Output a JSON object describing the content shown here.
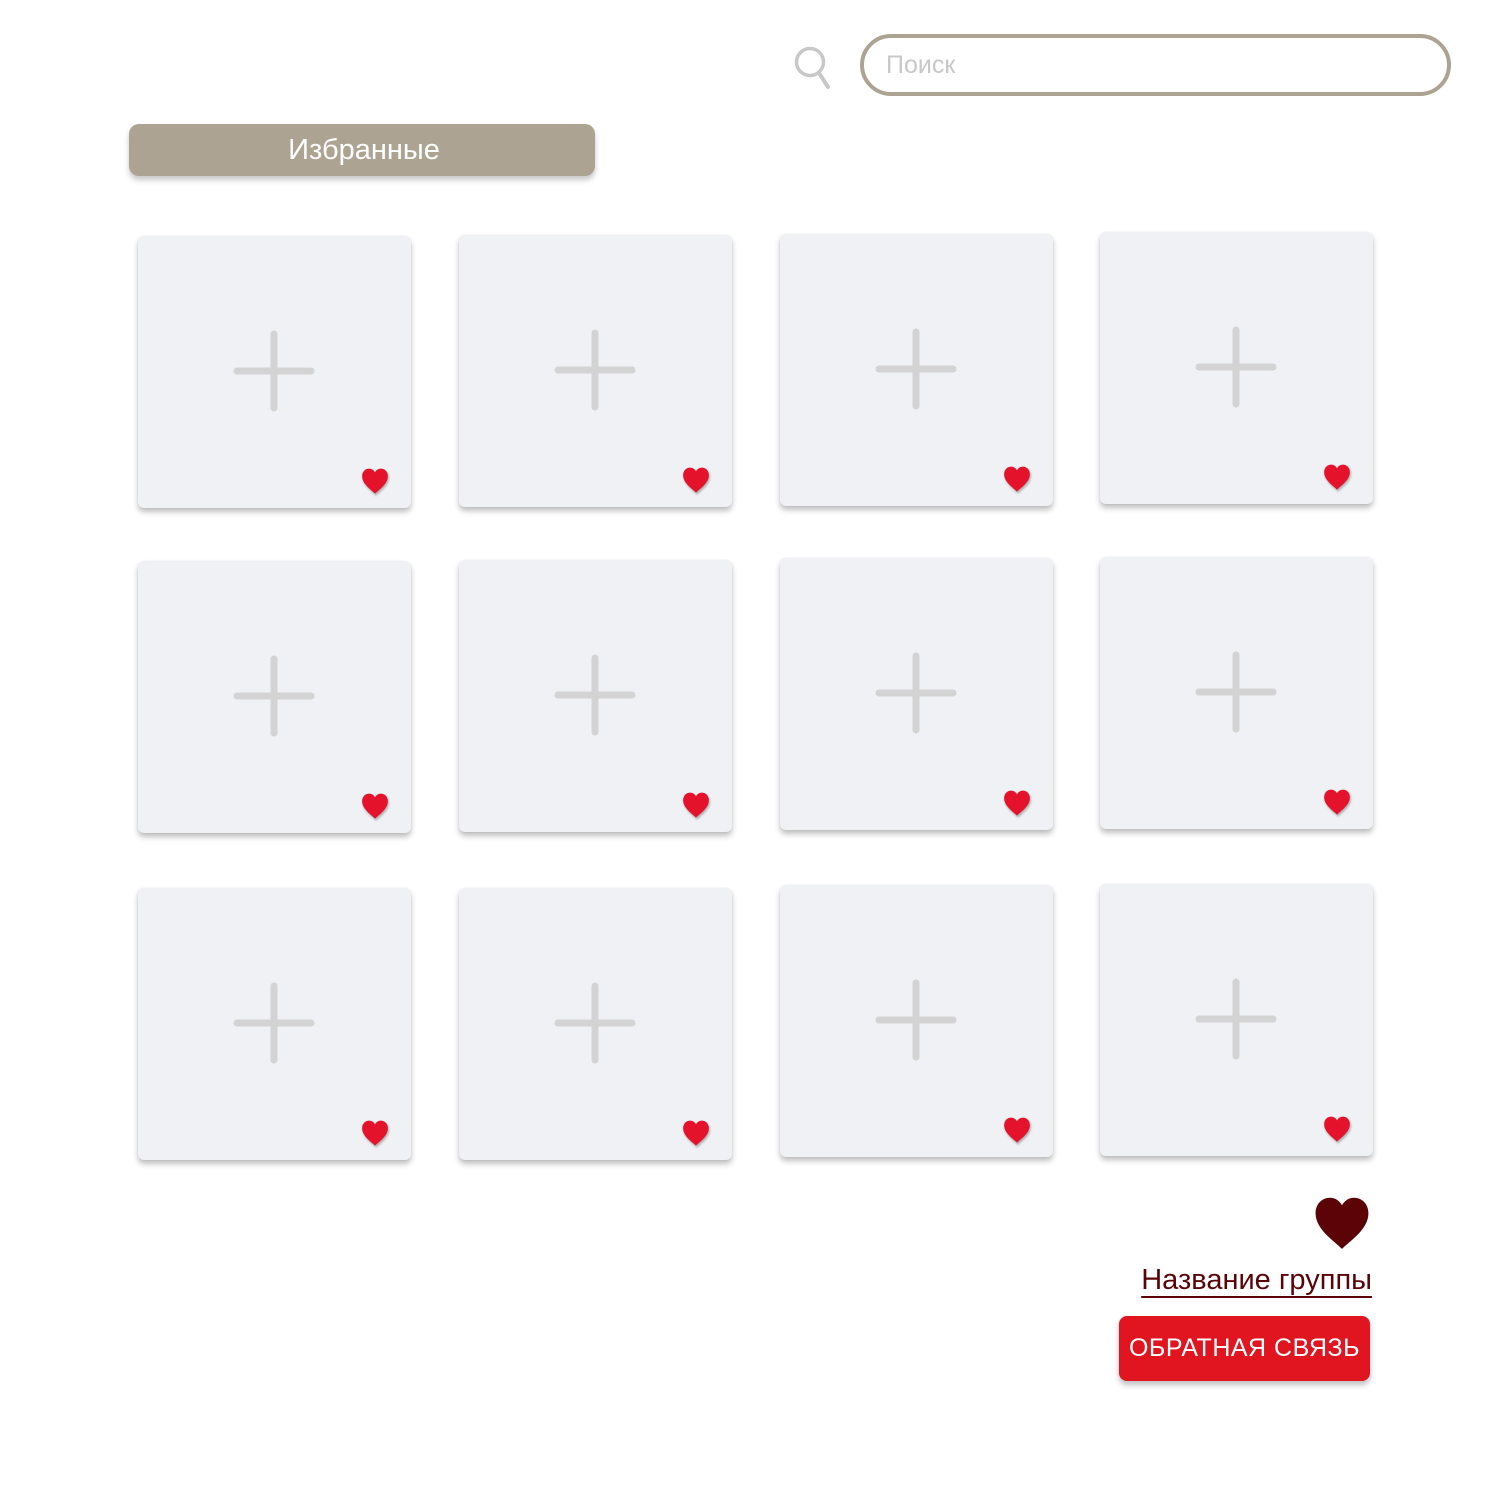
{
  "search": {
    "placeholder": "Поиск",
    "value": "",
    "icon": "search-icon"
  },
  "favorites": {
    "label": "Избранные"
  },
  "cards": [
    {
      "icon": "plus-icon",
      "favorite_icon": "heart-icon",
      "favorited": true
    },
    {
      "icon": "plus-icon",
      "favorite_icon": "heart-icon",
      "favorited": true
    },
    {
      "icon": "plus-icon",
      "favorite_icon": "heart-icon",
      "favorited": true
    },
    {
      "icon": "plus-icon",
      "favorite_icon": "heart-icon",
      "favorited": true
    },
    {
      "icon": "plus-icon",
      "favorite_icon": "heart-icon",
      "favorited": true
    },
    {
      "icon": "plus-icon",
      "favorite_icon": "heart-icon",
      "favorited": true
    },
    {
      "icon": "plus-icon",
      "favorite_icon": "heart-icon",
      "favorited": true
    },
    {
      "icon": "plus-icon",
      "favorite_icon": "heart-icon",
      "favorited": true
    },
    {
      "icon": "plus-icon",
      "favorite_icon": "heart-icon",
      "favorited": true
    },
    {
      "icon": "plus-icon",
      "favorite_icon": "heart-icon",
      "favorited": true
    },
    {
      "icon": "plus-icon",
      "favorite_icon": "heart-icon",
      "favorited": true
    },
    {
      "icon": "plus-icon",
      "favorite_icon": "heart-icon",
      "favorited": true
    }
  ],
  "footer": {
    "group_icon": "heart-icon",
    "group_name": "Название группы",
    "feedback_label": "ОБРАТНАЯ СВЯЗЬ"
  },
  "colors": {
    "accent_beige": "#aca392",
    "card_bg": "#f0f1f4",
    "plus_gray": "#d3d3d3",
    "heart_red": "#e4122b",
    "dark_red": "#5c0308",
    "button_red": "#e0151f",
    "search_icon": "#c8c8c8"
  }
}
